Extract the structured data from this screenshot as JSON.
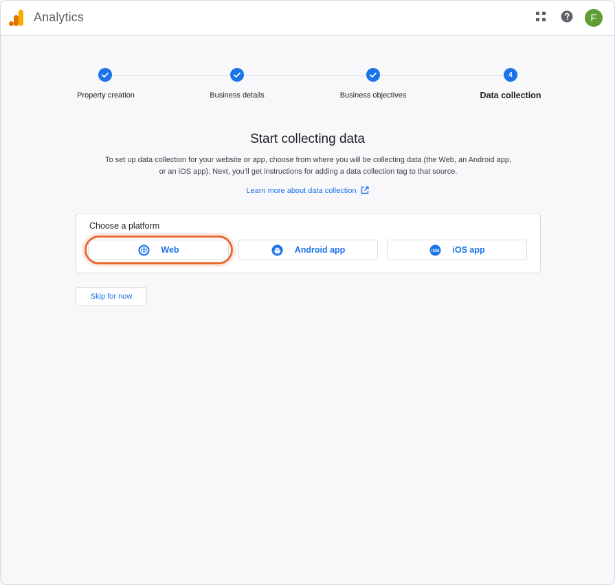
{
  "header": {
    "app_title": "Analytics",
    "avatar_letter": "F"
  },
  "stepper": {
    "steps": [
      {
        "label": "Property creation",
        "state": "completed"
      },
      {
        "label": "Business details",
        "state": "completed"
      },
      {
        "label": "Business objectives",
        "state": "completed"
      },
      {
        "label": "Data collection",
        "state": "current",
        "number": "4"
      }
    ]
  },
  "main": {
    "heading": "Start collecting data",
    "description": "To set up data collection for your website or app, choose from where you will be collecting data (the Web, an Android app, or an iOS app). Next, you'll get instructions for adding a data collection tag to that source.",
    "learn_more": "Learn more about data collection",
    "platform_card": {
      "title": "Choose a platform",
      "options": [
        {
          "label": "Web",
          "icon": "globe-icon",
          "highlighted": true
        },
        {
          "label": "Android app",
          "icon": "android-icon"
        },
        {
          "label": "iOS app",
          "icon": "ios-icon",
          "icon_text": "iOS"
        }
      ]
    },
    "skip_label": "Skip for now"
  },
  "colors": {
    "accent": "#1a73e8",
    "highlight": "#e9682f",
    "avatar": "#5f9e32",
    "logo_dark": "#e37400",
    "logo_light": "#f9ab00"
  }
}
